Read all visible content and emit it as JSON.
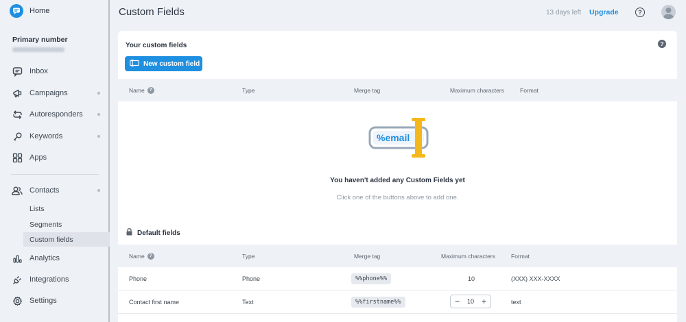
{
  "sidebar": {
    "home_label": "Home",
    "primary_number_label": "Primary number",
    "items": [
      {
        "label": "Inbox",
        "icon": "inbox-icon"
      },
      {
        "label": "Campaigns",
        "icon": "megaphone-icon"
      },
      {
        "label": "Autoresponders",
        "icon": "autoresponder-icon"
      },
      {
        "label": "Keywords",
        "icon": "key-icon"
      },
      {
        "label": "Apps",
        "icon": "apps-grid-icon"
      },
      {
        "label": "Contacts",
        "icon": "contacts-icon"
      },
      {
        "label": "Analytics",
        "icon": "analytics-icon"
      },
      {
        "label": "Integrations",
        "icon": "plug-icon"
      },
      {
        "label": "Settings",
        "icon": "gear-icon"
      }
    ],
    "contacts_sub": [
      "Lists",
      "Segments",
      "Custom fields"
    ]
  },
  "header": {
    "title": "Custom Fields",
    "trial": "13 days left",
    "upgrade": "Upgrade"
  },
  "card": {
    "title": "Your custom fields",
    "new_button": "New custom field",
    "columns": [
      "Name",
      "Type",
      "Merge tag",
      "Maximum characters",
      "Format"
    ],
    "empty_art_tag": "%email",
    "empty_title": "You haven't added any Custom Fields yet",
    "empty_sub": "Click one of the buttons above to add one."
  },
  "default_fields": {
    "title": "Default fields",
    "columns": [
      "Name",
      "Type",
      "Merge tag",
      "Maximum characters",
      "Format"
    ],
    "rows": [
      {
        "name": "Phone",
        "type": "Phone",
        "merge_tag": "%%phone%%",
        "max_chars": "10",
        "format": "(XXX) XXX-XXXX"
      },
      {
        "name": "Contact first name",
        "type": "Text",
        "merge_tag": "%%firstname%%",
        "max_chars": "10",
        "format": "text"
      }
    ]
  },
  "colors": {
    "accent": "#1f8fe0",
    "sidebar_bg": "#eef1f5",
    "illustration_yellow": "#f5b81c"
  }
}
